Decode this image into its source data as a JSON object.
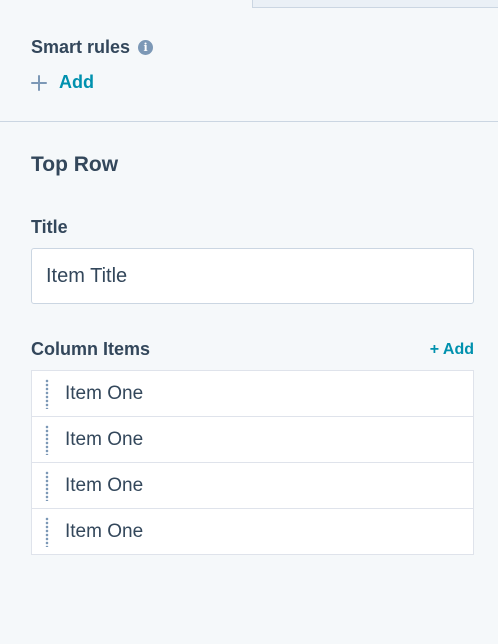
{
  "smart_rules": {
    "heading": "Smart rules",
    "info_icon": "info-icon",
    "add_label": "Add"
  },
  "section": {
    "title": "Top Row"
  },
  "title_field": {
    "label": "Title",
    "value": "Item Title"
  },
  "column_items": {
    "label": "Column Items",
    "add_label": "+ Add",
    "items": [
      {
        "label": "Item One"
      },
      {
        "label": "Item One"
      },
      {
        "label": "Item One"
      },
      {
        "label": "Item One"
      }
    ]
  },
  "colors": {
    "accent": "#0091ae",
    "text": "#33475b",
    "icon": "#7c98b6",
    "background": "#f5f8fa",
    "border": "#cbd6e2"
  }
}
